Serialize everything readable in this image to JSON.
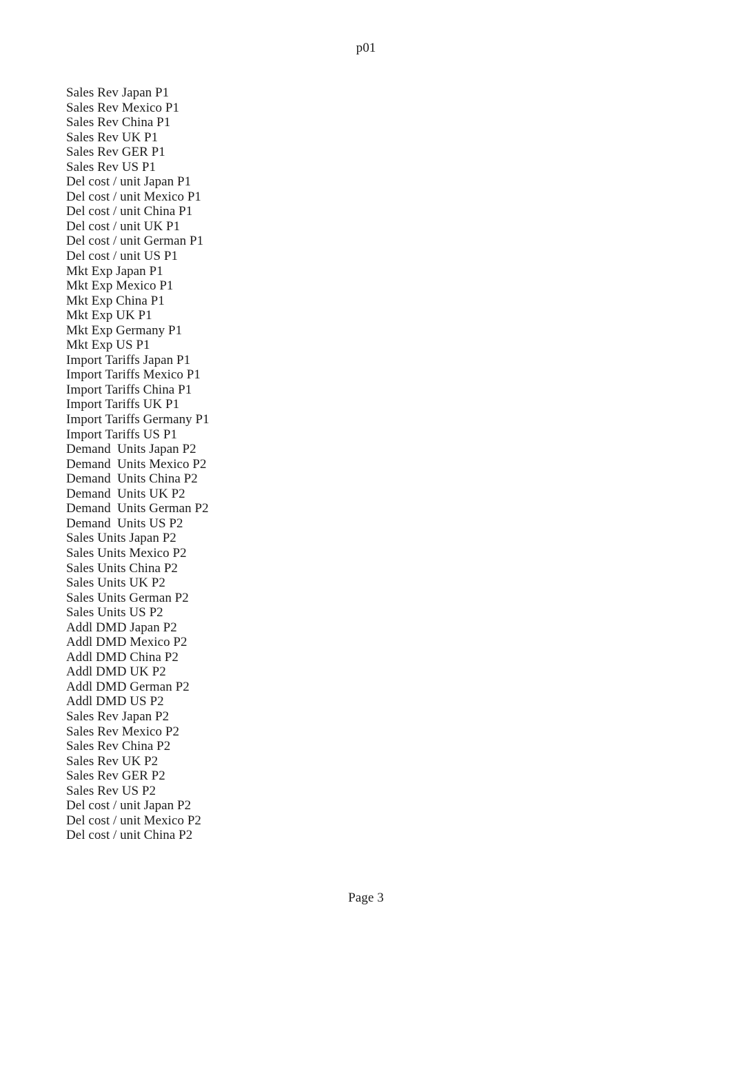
{
  "document": {
    "header": "p01",
    "footer": "Page 3",
    "lines": [
      {
        "text": "Sales Rev Japan P1"
      },
      {
        "text": "Sales Rev Mexico P1"
      },
      {
        "text": "Sales Rev China P1"
      },
      {
        "text": "Sales Rev UK P1"
      },
      {
        "text": "Sales Rev GER P1"
      },
      {
        "text": "Sales Rev US P1"
      },
      {
        "text": "Del cost / unit Japan P1"
      },
      {
        "text": "Del cost / unit Mexico P1"
      },
      {
        "text": "Del cost / unit China P1"
      },
      {
        "text": "Del cost / unit UK P1"
      },
      {
        "text": "Del cost / unit German P1"
      },
      {
        "text": "Del cost / unit US P1"
      },
      {
        "text": "Mkt Exp Japan P1"
      },
      {
        "text": "Mkt Exp Mexico P1"
      },
      {
        "text": "Mkt Exp China P1"
      },
      {
        "text": "Mkt Exp UK P1"
      },
      {
        "text": "Mkt Exp Germany P1"
      },
      {
        "text": "Mkt Exp US P1"
      },
      {
        "text": "Import Tariffs Japan P1"
      },
      {
        "text": "Import Tariffs Mexico P1"
      },
      {
        "text": "Import Tariffs China P1"
      },
      {
        "text": "Import Tariffs UK P1"
      },
      {
        "text": "Import Tariffs Germany P1"
      },
      {
        "text": "Import Tariffs US P1"
      },
      {
        "text": "Demand",
        "tab_text": "Units Japan P2"
      },
      {
        "text": "Demand",
        "tab_text": "Units Mexico P2"
      },
      {
        "text": "Demand",
        "tab_text": "Units China P2"
      },
      {
        "text": "Demand",
        "tab_text": "Units UK P2"
      },
      {
        "text": "Demand",
        "tab_text": "Units German P2"
      },
      {
        "text": "Demand",
        "tab_text": "Units US P2"
      },
      {
        "text": "Sales Units Japan P2"
      },
      {
        "text": "Sales Units Mexico P2"
      },
      {
        "text": "Sales Units China P2"
      },
      {
        "text": "Sales Units UK P2"
      },
      {
        "text": "Sales Units German P2"
      },
      {
        "text": "Sales Units US P2"
      },
      {
        "text": "Addl DMD Japan P2"
      },
      {
        "text": "Addl DMD Mexico P2"
      },
      {
        "text": "Addl DMD China P2"
      },
      {
        "text": "Addl DMD UK P2"
      },
      {
        "text": "Addl DMD German P2"
      },
      {
        "text": "Addl DMD US P2"
      },
      {
        "text": "Sales Rev Japan P2"
      },
      {
        "text": "Sales Rev Mexico P2"
      },
      {
        "text": "Sales Rev China P2"
      },
      {
        "text": "Sales Rev UK P2"
      },
      {
        "text": "Sales Rev GER P2"
      },
      {
        "text": "Sales Rev US P2"
      },
      {
        "text": "Del cost / unit Japan P2"
      },
      {
        "text": "Del cost / unit Mexico P2"
      },
      {
        "text": "Del cost / unit China P2"
      }
    ]
  }
}
